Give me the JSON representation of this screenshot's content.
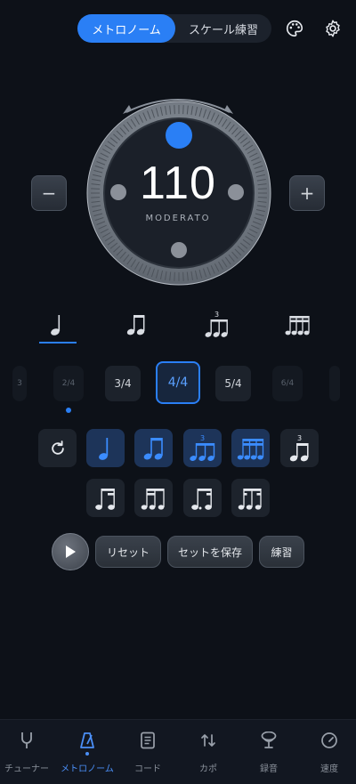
{
  "mode_tabs": [
    "メトロノーム",
    "スケール練習"
  ],
  "icons": {
    "theme": "palette-icon",
    "settings": "gear-icon"
  },
  "colors": {
    "accent": "#2a7ff5",
    "background": "#0d1118"
  },
  "tempo": {
    "bpm": "110",
    "name": "MODERATO",
    "minus": "−",
    "plus": "+"
  },
  "subdivisions": [
    "quarter",
    "eighth",
    "triplet",
    "sixteenth"
  ],
  "subdivision_triplet_mark": "3",
  "time_signatures": [
    "3",
    "2/4",
    "3/4",
    "4/4",
    "5/4",
    "6/4"
  ],
  "selected_time_signature": "4/4",
  "rhythm_triplet_mark": "3",
  "controls": {
    "reset": "リセット",
    "save_set": "セットを保存",
    "practice": "練習"
  },
  "nav": {
    "items": [
      "チューナー",
      "メトロノーム",
      "コード",
      "カポ",
      "録音",
      "速度"
    ],
    "active": "メトロノーム"
  }
}
